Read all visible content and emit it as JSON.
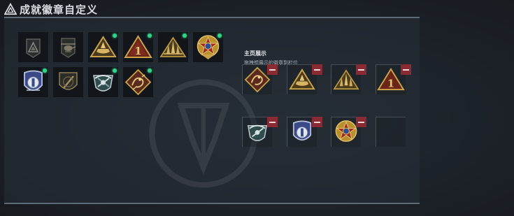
{
  "page": {
    "title": "成就徽章自定义",
    "title_icon": "triangle-logo-icon"
  },
  "showcase": {
    "title": "主页展示",
    "subtitle": "拖拽想展示的徽章到栏位"
  },
  "colors": {
    "new_indicator": "#2fd68a",
    "remove_button": "#8a2a32",
    "badge_gold": "#c9a24a",
    "background": "#1b2026"
  },
  "collection": [
    {
      "id": "b1",
      "icon": "triangle-mountain-badge-icon",
      "is_new": false,
      "locked": true
    },
    {
      "id": "b2",
      "icon": "helicopter-badge-icon",
      "is_new": false,
      "locked": true
    },
    {
      "id": "b3",
      "icon": "triangle-boat-badge-icon",
      "is_new": true,
      "locked": false
    },
    {
      "id": "b4",
      "icon": "triangle-number-one-badge-icon",
      "is_new": true,
      "locked": false
    },
    {
      "id": "b5",
      "icon": "triangle-spires-badge-icon",
      "is_new": true,
      "locked": false
    },
    {
      "id": "b6",
      "icon": "star-medal-badge-icon",
      "is_new": true,
      "locked": false
    },
    {
      "id": "b7",
      "icon": "shield-insignia-badge-icon",
      "is_new": true,
      "locked": false
    },
    {
      "id": "b8",
      "icon": "shield-blade-badge-icon",
      "is_new": false,
      "locked": true
    },
    {
      "id": "b9",
      "icon": "winged-emblem-badge-icon",
      "is_new": true,
      "locked": false
    },
    {
      "id": "b10",
      "icon": "diamond-dragon-badge-icon",
      "is_new": true,
      "locked": false
    }
  ],
  "display_slots": [
    {
      "icon": "diamond-dragon-badge-icon",
      "filled": true
    },
    {
      "icon": "triangle-boat-badge-icon",
      "filled": true
    },
    {
      "icon": "triangle-spires-badge-icon",
      "filled": true
    },
    {
      "icon": "triangle-number-one-badge-icon",
      "filled": true
    },
    {
      "icon": "winged-emblem-badge-icon",
      "filled": true
    },
    {
      "icon": "shield-insignia-badge-icon",
      "filled": true
    },
    {
      "icon": "star-medal-badge-icon",
      "filled": true
    },
    {
      "icon": "empty-slot",
      "filled": false
    }
  ],
  "badge_text": {
    "number_one": "1"
  }
}
